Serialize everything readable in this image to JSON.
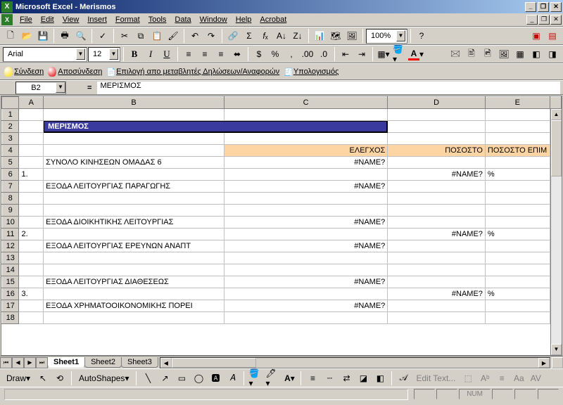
{
  "title": "Microsoft Excel - Merismos",
  "menu": [
    "File",
    "Edit",
    "View",
    "Insert",
    "Format",
    "Tools",
    "Data",
    "Window",
    "Help",
    "Acrobat"
  ],
  "font_name": "Arial",
  "font_size": "12",
  "zoom": "100%",
  "custom_toolbar": {
    "connect": "Σύνδεση",
    "disconnect": "Αποσύνδεση",
    "select_vars": "Επιλογή απο μεταβλητές Δηλώσεων/Αναφορών",
    "calc": "Υπολογισμός"
  },
  "name_box": "B2",
  "formula_bar": "ΜΕΡΙΣΜΟΣ",
  "columns": [
    "A",
    "B",
    "C",
    "D",
    "E"
  ],
  "rows": [
    {
      "r": "1",
      "A": "",
      "B": "",
      "C": "",
      "D": "",
      "E": ""
    },
    {
      "r": "2",
      "A": "",
      "B": "ΜΕΡΙΣΜΟΣ",
      "merged": true
    },
    {
      "r": "3",
      "A": "",
      "B": "",
      "C": "",
      "D": "",
      "E": ""
    },
    {
      "r": "4",
      "A": "",
      "B": "",
      "C": "ΕΛΕΓΧΟΣ",
      "D": "ΠΟΣΟΣΤΟ",
      "E": "ΠΟΣΟΣΤΟ ΕΠΙΜ",
      "header": true
    },
    {
      "r": "5",
      "A": "",
      "B": "ΣΥΝΟΛΟ ΚΙΝΗΣΕΩΝ ΟΜΑΔΑΣ 6",
      "C": "#NAME?",
      "D": "",
      "E": ""
    },
    {
      "r": "6",
      "A": "1.",
      "B": "",
      "C": "",
      "D": "#NAME?",
      "E": "%"
    },
    {
      "r": "7",
      "A": "",
      "B": "ΕΞΟΔΑ ΛΕΙΤΟΥΡΓΙΑΣ ΠΑΡΑΓΩΓΗΣ",
      "C": "#NAME?",
      "D": "",
      "E": ""
    },
    {
      "r": "8",
      "A": "",
      "B": "",
      "C": "",
      "D": "",
      "E": ""
    },
    {
      "r": "9",
      "A": "",
      "B": "",
      "C": "",
      "D": "",
      "E": ""
    },
    {
      "r": "10",
      "A": "",
      "B": "ΕΞΟΔΑ ΔΙΟΙΚΗΤΙΚΗΣ ΛΕΙΤΟΥΡΓΙΑΣ",
      "C": "#NAME?",
      "D": "",
      "E": ""
    },
    {
      "r": "11",
      "A": "2.",
      "B": "",
      "C": "",
      "D": "#NAME?",
      "E": "%"
    },
    {
      "r": "12",
      "A": "",
      "B": "ΕΞΟΔΑ ΛΕΙΤΟΥΡΓΙΑΣ ΕΡΕΥΝΩΝ ΑΝΑΠΤ",
      "C": "#NAME?",
      "D": "",
      "E": ""
    },
    {
      "r": "13",
      "A": "",
      "B": "",
      "C": "",
      "D": "",
      "E": ""
    },
    {
      "r": "14",
      "A": "",
      "B": "",
      "C": "",
      "D": "",
      "E": ""
    },
    {
      "r": "15",
      "A": "",
      "B": "ΕΞΟΔΑ ΛΕΙΤΟΥΡΓΙΑΣ ΔΙΑΘΕΣΕΩΣ",
      "C": "#NAME?",
      "D": "",
      "E": ""
    },
    {
      "r": "16",
      "A": "3.",
      "B": "",
      "C": "",
      "D": "#NAME?",
      "E": "%"
    },
    {
      "r": "17",
      "A": "",
      "B": "ΕΞΟΔΑ ΧΡΗΜΑΤΟΟΙΚΟΝΟΜΙΚΗΣ ΠΟΡΕΙ",
      "C": "#NAME?",
      "D": "",
      "E": ""
    },
    {
      "r": "18",
      "A": "",
      "B": "",
      "C": "",
      "D": "",
      "E": ""
    }
  ],
  "sheets": [
    "Sheet1",
    "Sheet2",
    "Sheet3"
  ],
  "active_sheet": 0,
  "draw_label": "Draw",
  "autoshapes_label": "AutoShapes",
  "edit_text_label": "Edit Text...",
  "status_boxes": [
    "NUM"
  ],
  "chart_data": null
}
